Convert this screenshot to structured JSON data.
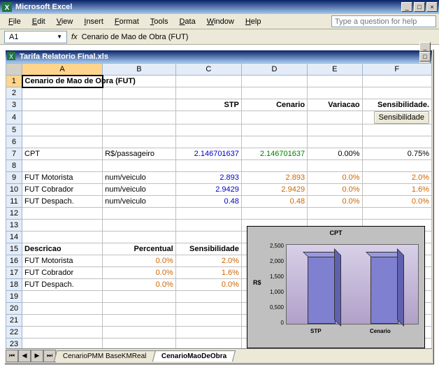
{
  "app": {
    "title": "Microsoft Excel"
  },
  "menus": [
    "File",
    "Edit",
    "View",
    "Insert",
    "Format",
    "Tools",
    "Data",
    "Window",
    "Help"
  ],
  "help_placeholder": "Type a question for help",
  "namebox": "A1",
  "fx": "fx",
  "formula": "Cenario de Mao de Obra (FUT)",
  "workbook": {
    "name": "Tarifa Relatorio Final.xls"
  },
  "columns": [
    "A",
    "B",
    "C",
    "D",
    "E",
    "F"
  ],
  "rows_visible": 23,
  "cells": {
    "A1": "Cenario de Mao de Obra (FUT)",
    "C3": "STP",
    "D3": "Cenario",
    "E3": "Variacao",
    "F3": "Sensibilidade.",
    "F4_button": "Sensibilidade",
    "A7": "CPT",
    "B7": "R$/passageiro",
    "C7": "2.146701637",
    "D7": "2.146701637",
    "E7": "0.00%",
    "F7": "0.75%",
    "A9": "FUT Motorista",
    "B9": "num/veiculo",
    "C9": "2.893",
    "D9": "2.893",
    "E9": "0.0%",
    "F9": "2.0%",
    "A10": "FUT Cobrador",
    "B10": "num/veiculo",
    "C10": "2.9429",
    "D10": "2.9429",
    "E10": "0.0%",
    "F10": "1.6%",
    "A11": "FUT Despach.",
    "B11": "num/veiculo",
    "C11": "0.48",
    "D11": "0.48",
    "E11": "0.0%",
    "F11": "0.0%",
    "A15": "Descricao",
    "B15": "Percentual",
    "C15": "Sensibilidade",
    "A16": "FUT Motorista",
    "B16": "0.0%",
    "C16": "2.0%",
    "A17": "FUT Cobrador",
    "B17": "0.0%",
    "C17": "1.6%",
    "A18": "FUT Despach.",
    "B18": "0.0%",
    "C18": "0.0%"
  },
  "sheet_tabs": {
    "inactive": "CenarioPMM BaseKMReal",
    "active": "CenarioMaoDeObra"
  },
  "chart_data": {
    "type": "bar",
    "title": "CPT",
    "ylabel": "R$",
    "ylim": [
      0,
      2.5
    ],
    "yticks": [
      "0",
      "0,500",
      "1,000",
      "1,500",
      "2,000",
      "2,500"
    ],
    "categories": [
      "STP",
      "Cenario"
    ],
    "values": [
      2.1467,
      2.1467
    ]
  }
}
